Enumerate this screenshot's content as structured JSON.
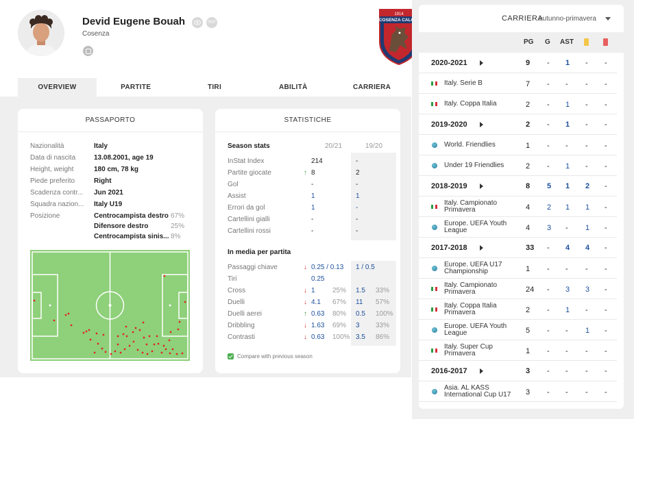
{
  "player": {
    "name": "Devid Eugene Bouah",
    "team": "Cosenza",
    "icons": [
      "eye-icon",
      "pdf-icon",
      "instagram-icon"
    ],
    "pdf_label": "PDF"
  },
  "club_logo": {
    "year": "1914",
    "name": "COSENZA CALCIO",
    "colors": {
      "red": "#c1272d",
      "blue": "#1f3a73"
    }
  },
  "tabs": [
    "OVERVIEW",
    "PARTITE",
    "TIRI",
    "ABILITÀ",
    "CARRIERA"
  ],
  "passaporto": {
    "title": "PASSAPORTO",
    "rows": [
      {
        "label": "Nazionalità",
        "value": "Italy"
      },
      {
        "label": "Data di nascita",
        "value": "13.08.2001, age 19"
      },
      {
        "label": "Height, weight",
        "value": "180 cm, 78 kg"
      },
      {
        "label": "Piede preferito",
        "value": "Right"
      },
      {
        "label": "Scadenza contr...",
        "value": "Jun 2021"
      },
      {
        "label": "Squadra nazion...",
        "value": "Italy U19"
      }
    ],
    "position_label": "Posizione",
    "positions": [
      {
        "name": "Centrocampista destro",
        "pct": "67%"
      },
      {
        "name": "Difensore destro",
        "pct": "25%"
      },
      {
        "name": "Centrocampista sinis...",
        "pct": "8%"
      }
    ],
    "pitch_color": "#8fd07a"
  },
  "statistiche": {
    "title": "STATISTICHE",
    "season_head": "Season stats",
    "col_cur": "20/21",
    "col_prev": "19/20",
    "season_rows": [
      {
        "label": "InStat Index",
        "trend": "",
        "cur": "214",
        "prev": "-"
      },
      {
        "label": "Partite giocate",
        "trend": "up",
        "cur": "8",
        "prev": "2"
      },
      {
        "label": "Gol",
        "trend": "",
        "cur": "-",
        "prev": "-"
      },
      {
        "label": "Assist",
        "trend": "",
        "cur": "1",
        "prev": "1"
      },
      {
        "label": "Errori da gol",
        "trend": "",
        "cur": "1",
        "prev": "-"
      },
      {
        "label": "Cartellini gialli",
        "trend": "",
        "cur": "-",
        "prev": "-"
      },
      {
        "label": "Cartellini rossi",
        "trend": "",
        "cur": "-",
        "prev": "-"
      }
    ],
    "avg_head": "In media per partita",
    "avg_rows": [
      {
        "label": "Passaggi chiave",
        "trend": "down",
        "cur": "0.25 / 0.13",
        "cur_pct": "",
        "prev": "1 / 0.5",
        "prev_pct": ""
      },
      {
        "label": "Tiri",
        "trend": "",
        "cur": "0.25",
        "cur_pct": "",
        "prev": "",
        "prev_pct": ""
      },
      {
        "label": "Cross",
        "trend": "down",
        "cur": "1",
        "cur_pct": "25%",
        "prev": "1.5",
        "prev_pct": "33%"
      },
      {
        "label": "Duelli",
        "trend": "down",
        "cur": "4.1",
        "cur_pct": "67%",
        "prev": "11",
        "prev_pct": "57%"
      },
      {
        "label": "Duelli aerei",
        "trend": "up",
        "cur": "0.63",
        "cur_pct": "80%",
        "prev": "0.5",
        "prev_pct": "100%"
      },
      {
        "label": "Dribbling",
        "trend": "down",
        "cur": "1.63",
        "cur_pct": "69%",
        "prev": "3",
        "prev_pct": "33%"
      },
      {
        "label": "Contrasti",
        "trend": "down",
        "cur": "0.63",
        "cur_pct": "100%",
        "prev": "3.5",
        "prev_pct": "86%"
      }
    ],
    "compare_label": "Compare with previous season"
  },
  "carriera": {
    "title": "CARRIERA",
    "filter": "autunno-primavera",
    "columns": [
      "PG",
      "G",
      "AST"
    ],
    "rows": [
      {
        "type": "season",
        "label": "2020-2021",
        "pg": "9",
        "g": "-",
        "ast": "1",
        "y": "-",
        "r": "-"
      },
      {
        "type": "comp",
        "icon": "italy-flag",
        "label": "Italy. Serie B",
        "pg": "7",
        "g": "-",
        "ast": "-",
        "y": "-",
        "r": "-"
      },
      {
        "type": "comp",
        "icon": "italy-flag",
        "label": "Italy. Coppa Italia",
        "pg": "2",
        "g": "-",
        "ast": "1",
        "y": "-",
        "r": "-"
      },
      {
        "type": "season",
        "label": "2019-2020",
        "pg": "2",
        "g": "-",
        "ast": "1",
        "y": "-",
        "r": "-"
      },
      {
        "type": "comp",
        "icon": "globe",
        "label": "World. Friendlies",
        "pg": "1",
        "g": "-",
        "ast": "-",
        "y": "-",
        "r": "-"
      },
      {
        "type": "comp",
        "icon": "globe",
        "label": "Under 19 Friendlies",
        "pg": "2",
        "g": "-",
        "ast": "1",
        "y": "-",
        "r": "-"
      },
      {
        "type": "season",
        "label": "2018-2019",
        "pg": "8",
        "g": "5",
        "ast": "1",
        "y": "2",
        "r": "-"
      },
      {
        "type": "comp",
        "icon": "italy-flag",
        "label": "Italy. Campionato Primavera",
        "pg": "4",
        "g": "2",
        "ast": "1",
        "y": "1",
        "r": "-"
      },
      {
        "type": "comp",
        "icon": "globe",
        "label": "Europe. UEFA Youth League",
        "pg": "4",
        "g": "3",
        "ast": "-",
        "y": "1",
        "r": "-"
      },
      {
        "type": "season",
        "label": "2017-2018",
        "pg": "33",
        "g": "-",
        "ast": "4",
        "y": "4",
        "r": "-"
      },
      {
        "type": "comp",
        "icon": "globe",
        "label": "Europe. UEFA U17 Championship",
        "pg": "1",
        "g": "-",
        "ast": "-",
        "y": "-",
        "r": "-"
      },
      {
        "type": "comp",
        "icon": "italy-flag",
        "label": "Italy. Campionato Primavera",
        "pg": "24",
        "g": "-",
        "ast": "3",
        "y": "3",
        "r": "-"
      },
      {
        "type": "comp",
        "icon": "italy-flag",
        "label": "Italy. Coppa Italia Primavera",
        "pg": "2",
        "g": "-",
        "ast": "1",
        "y": "-",
        "r": "-"
      },
      {
        "type": "comp",
        "icon": "globe",
        "label": "Europe. UEFA Youth League",
        "pg": "5",
        "g": "-",
        "ast": "-",
        "y": "1",
        "r": "-"
      },
      {
        "type": "comp",
        "icon": "italy-flag",
        "label": "Italy. Super Cup Primavera",
        "pg": "1",
        "g": "-",
        "ast": "-",
        "y": "-",
        "r": "-"
      },
      {
        "type": "season",
        "label": "2016-2017",
        "pg": "3",
        "g": "-",
        "ast": "-",
        "y": "-",
        "r": "-"
      },
      {
        "type": "comp",
        "icon": "globe",
        "label": "Asia. AL KASS International Cup U17",
        "pg": "3",
        "g": "-",
        "ast": "-",
        "y": "-",
        "r": "-"
      }
    ]
  }
}
